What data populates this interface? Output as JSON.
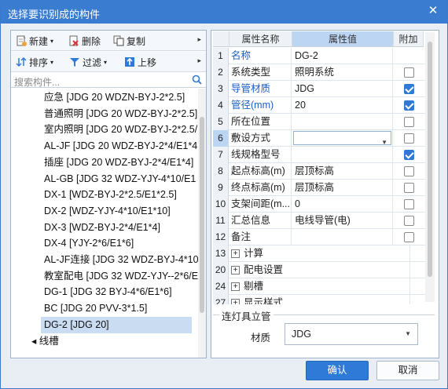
{
  "window": {
    "title": "选择要识别成的构件",
    "close_glyph": "✕"
  },
  "left_toolbar": {
    "new_label": "新建",
    "delete_label": "删除",
    "copy_label": "复制",
    "sort_label": "排序",
    "filter_label": "过滤",
    "move_up_label": "上移",
    "more_glyph": "▸"
  },
  "search": {
    "placeholder": "搜索构件..."
  },
  "tree": {
    "items": [
      "应急 [JDG 20 WDZN-BYJ-2*2.5]",
      "普通照明 [JDG 20 WDZ-BYJ-2*2.5]",
      "室内照明 [JDG 20 WDZ-BYJ-2*2.5/",
      "AL-JF [JDG 20 WDZ-BYJ-2*4/E1*4",
      "插座 [JDG 20 WDZ-BYJ-2*4/E1*4]",
      "AL-GB [JDG 32 WDZ-YJY-4*10/E1",
      "DX-1 [WDZ-BYJ-2*2.5/E1*2.5]",
      "DX-2 [WDZ-YJY-4*10/E1*10]",
      "DX-3 [WDZ-BYJ-2*4/E1*4]",
      "DX-4 [YJY-2*6/E1*6]",
      "AL-JF连接 [JDG 32 WDZ-BYJ-4*10",
      "教室配电 [JDG 32 WDZ-YJY--2*6/E",
      "DG-1 [JDG 32 BYJ-4*6/E1*6]",
      "BC [JDG 20 PVV-3*1.5]",
      "DG-2 [JDG 20]"
    ],
    "selected_index": 14,
    "partial_last": "◂ 线槽"
  },
  "grid": {
    "headers": {
      "name": "属性名称",
      "value": "属性值",
      "extra": "附加"
    },
    "rows": [
      {
        "n": "1",
        "name": "名称",
        "value": "DG-2",
        "blue": true,
        "cb": null
      },
      {
        "n": "2",
        "name": "系统类型",
        "value": "照明系统",
        "blue": false,
        "cb": false
      },
      {
        "n": "3",
        "name": "导管材质",
        "value": "JDG",
        "blue": true,
        "cb": true
      },
      {
        "n": "4",
        "name": "管径(mm)",
        "value": "20",
        "blue": true,
        "cb": true
      },
      {
        "n": "5",
        "name": "所在位置",
        "value": "",
        "blue": false,
        "cb": false
      },
      {
        "n": "6",
        "name": "敷设方式",
        "value": "",
        "blue": false,
        "cb": false,
        "combo": true
      },
      {
        "n": "7",
        "name": "线规格型号",
        "value": "",
        "blue": false,
        "cb": true
      },
      {
        "n": "8",
        "name": "起点标高(m)",
        "value": "层顶标高",
        "blue": false,
        "cb": false
      },
      {
        "n": "9",
        "name": "终点标高(m)",
        "value": "层顶标高",
        "blue": false,
        "cb": false
      },
      {
        "n": "10",
        "name": "支架间距(m...",
        "value": "0",
        "blue": false,
        "cb": false
      },
      {
        "n": "11",
        "name": "汇总信息",
        "value": "电线导管(电)",
        "blue": false,
        "cb": false
      },
      {
        "n": "12",
        "name": "备注",
        "value": "",
        "blue": false,
        "cb": false
      },
      {
        "n": "13",
        "name": "计算",
        "value": "",
        "group": true
      },
      {
        "n": "20",
        "name": "配电设置",
        "value": "",
        "group": true
      },
      {
        "n": "24",
        "name": "剔槽",
        "value": "",
        "group": true
      },
      {
        "n": "27",
        "name": "显示样式",
        "value": "",
        "group": true
      }
    ]
  },
  "group_box": {
    "legend": "连灯具立管",
    "material_label": "材质",
    "material_value": "JDG"
  },
  "buttons": {
    "ok": "确认",
    "cancel": "取消"
  }
}
